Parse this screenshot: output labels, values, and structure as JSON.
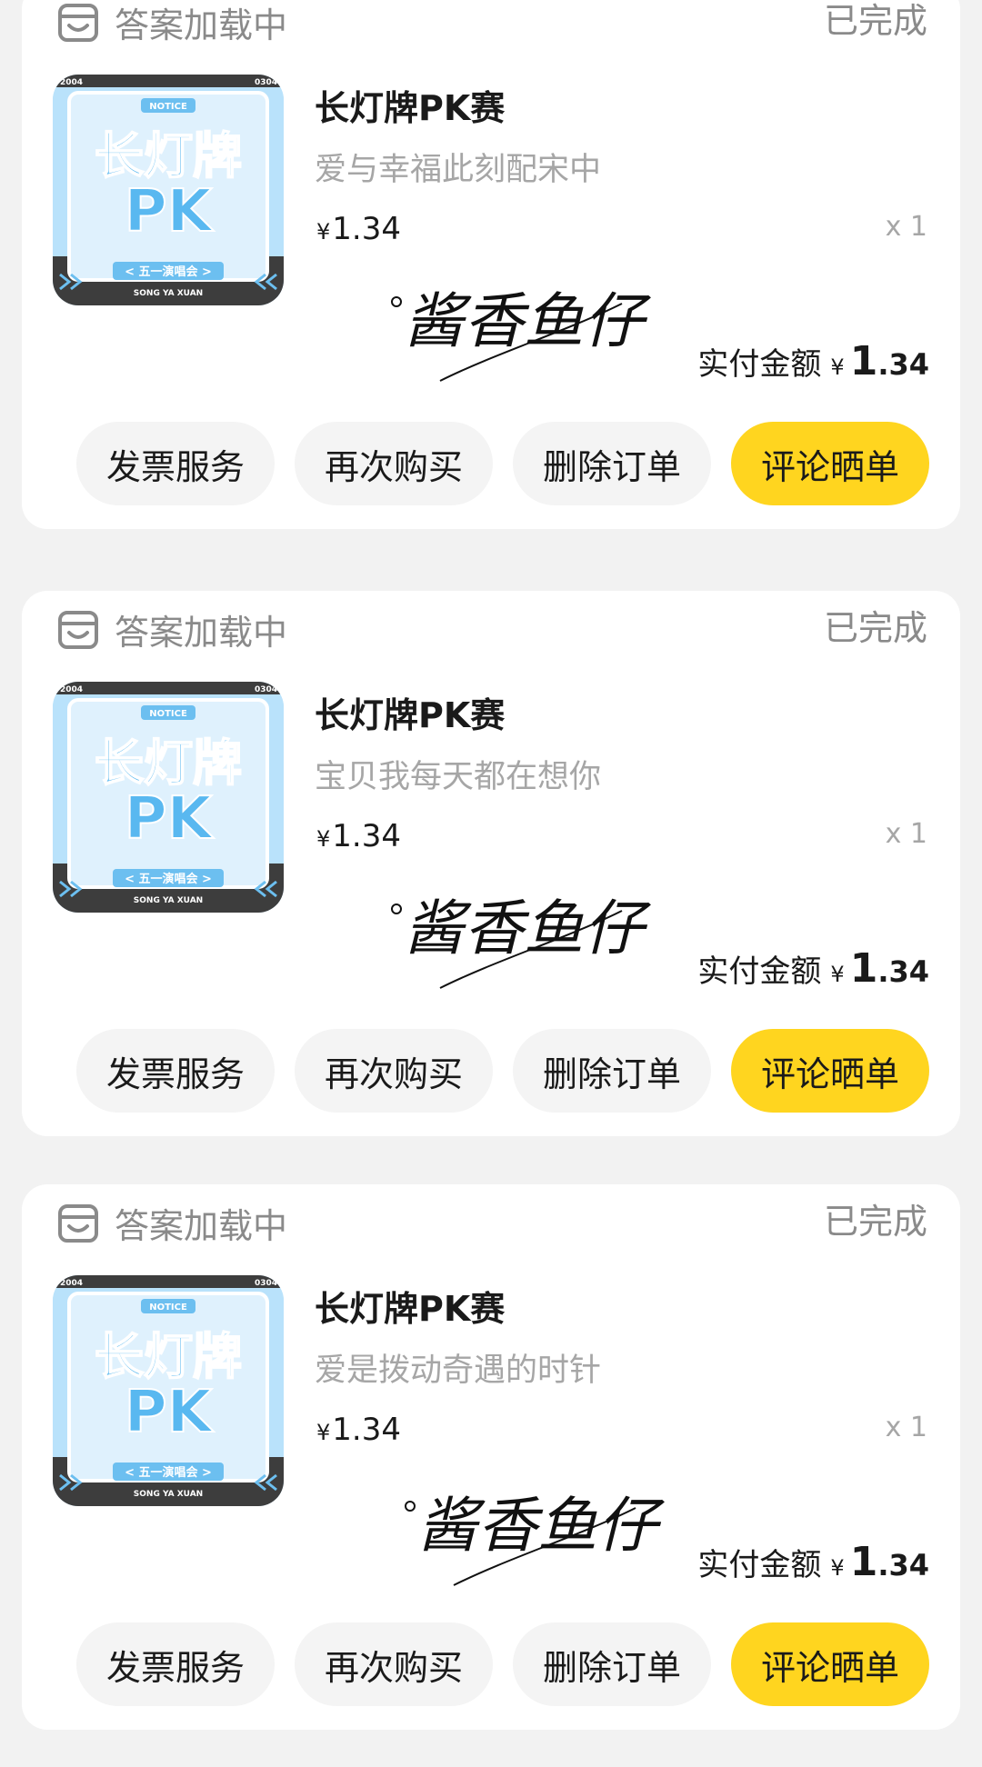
{
  "colors": {
    "page_bg": "#f2f2f2",
    "card_bg": "#ffffff",
    "accent": "#ffd51f",
    "muted": "#8a8a8a"
  },
  "orders": [
    {
      "shop_name": "答案加载中",
      "status": "已完成",
      "thumbnail_text": {
        "top_left": "2004",
        "top_right": "0304",
        "notice": "NOTICE",
        "line1": "长灯牌",
        "line2": "PK",
        "banner": "< 五一演唱会 >",
        "footer": "SONG YA XUAN"
      },
      "title": "长灯牌PK赛",
      "subtitle": "爱与幸福此刻配宋中",
      "price_symbol": "¥",
      "price": "1.34",
      "quantity": "x 1",
      "signature": "酱香鱼仔",
      "paid_label": "实付金额",
      "paid_symbol": "¥",
      "paid_int": "1",
      "paid_dec": ".34",
      "actions": {
        "invoice": "发票服务",
        "rebuy": "再次购买",
        "delete": "删除订单",
        "review": "评论晒单"
      }
    },
    {
      "shop_name": "答案加载中",
      "status": "已完成",
      "thumbnail_text": {
        "top_left": "2004",
        "top_right": "0304",
        "notice": "NOTICE",
        "line1": "长灯牌",
        "line2": "PK",
        "banner": "< 五一演唱会 >",
        "footer": "SONG YA XUAN"
      },
      "title": "长灯牌PK赛",
      "subtitle": "宝贝我每天都在想你",
      "price_symbol": "¥",
      "price": "1.34",
      "quantity": "x 1",
      "signature": "酱香鱼仔",
      "paid_label": "实付金额",
      "paid_symbol": "¥",
      "paid_int": "1",
      "paid_dec": ".34",
      "actions": {
        "invoice": "发票服务",
        "rebuy": "再次购买",
        "delete": "删除订单",
        "review": "评论晒单"
      }
    },
    {
      "shop_name": "答案加载中",
      "status": "已完成",
      "thumbnail_text": {
        "top_left": "2004",
        "top_right": "0304",
        "notice": "NOTICE",
        "line1": "长灯牌",
        "line2": "PK",
        "banner": "< 五一演唱会 >",
        "footer": "SONG YA XUAN"
      },
      "title": "长灯牌PK赛",
      "subtitle": "爱是拨动奇遇的时针",
      "price_symbol": "¥",
      "price": "1.34",
      "quantity": "x 1",
      "signature": "酱香鱼仔",
      "paid_label": "实付金额",
      "paid_symbol": "¥",
      "paid_int": "1",
      "paid_dec": ".34",
      "actions": {
        "invoice": "发票服务",
        "rebuy": "再次购买",
        "delete": "删除订单",
        "review": "评论晒单"
      }
    }
  ]
}
